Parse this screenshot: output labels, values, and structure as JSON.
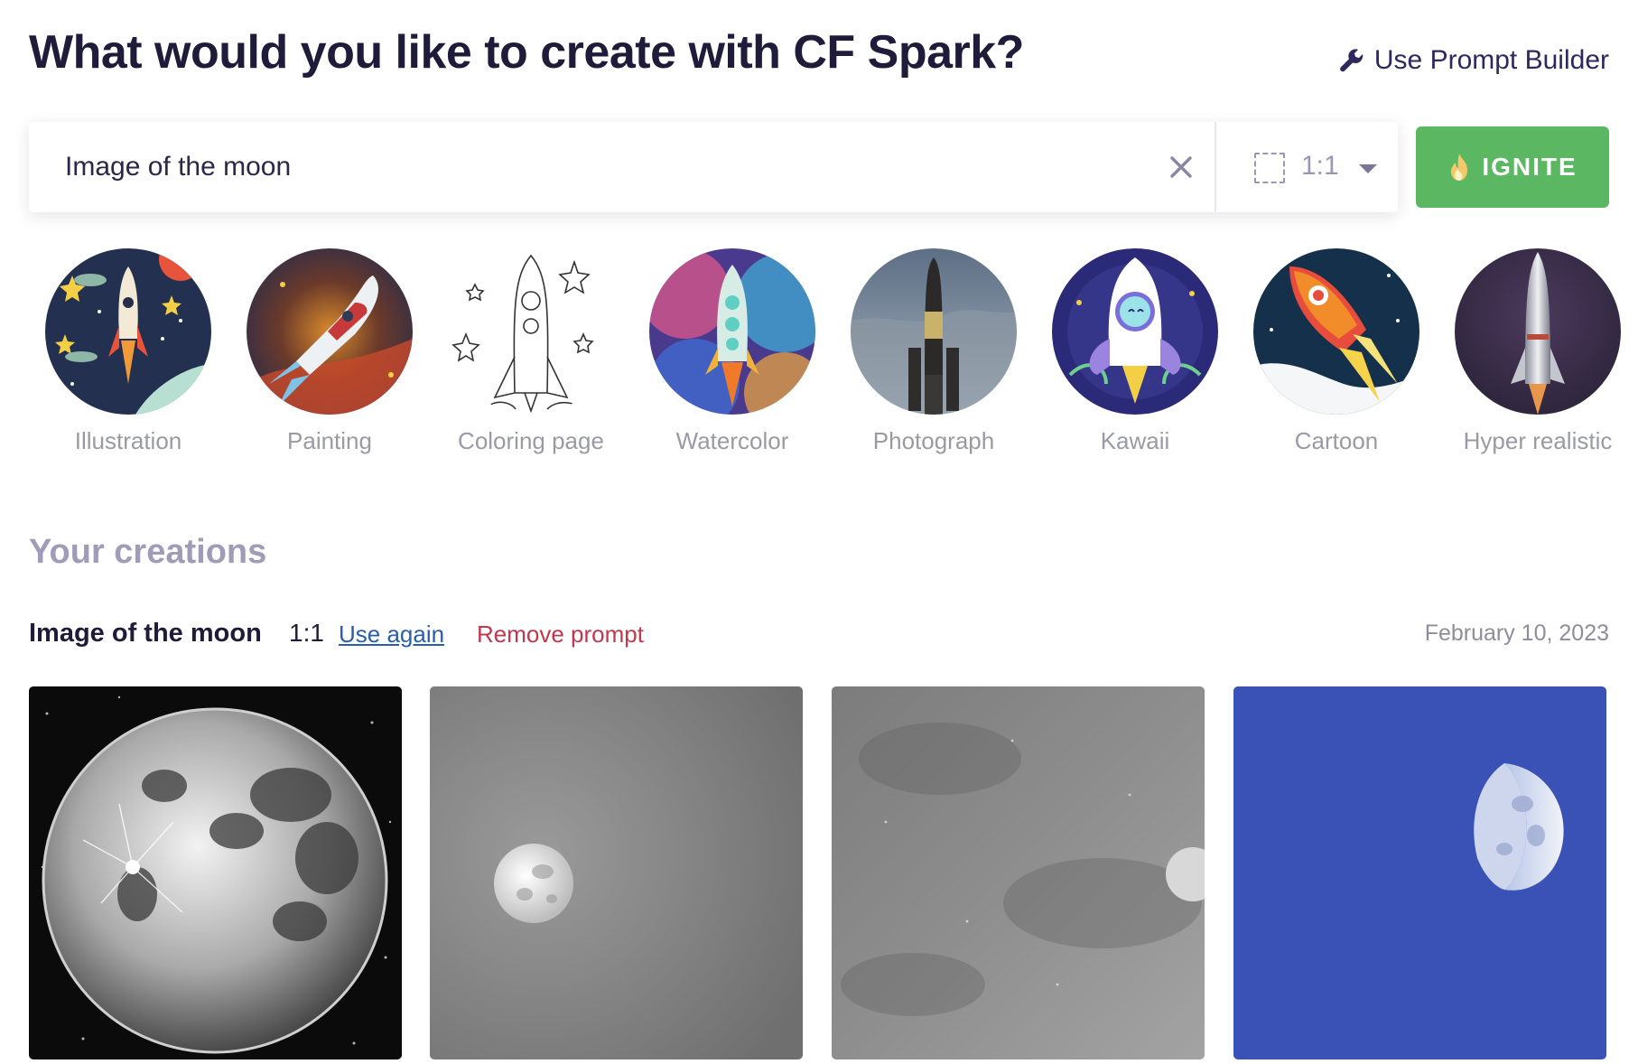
{
  "header": {
    "title": "What would you like to create with CF Spark?",
    "prompt_builder_label": "Use Prompt Builder",
    "prompt_builder_icon": "wrench-icon"
  },
  "search": {
    "value": "Image of the moon",
    "placeholder": "",
    "clear_icon": "close-icon",
    "ratio_icon": "aspect-ratio-icon",
    "ratio": "1:1",
    "ignite_label": "IGNITE",
    "ignite_icon": "flame-icon"
  },
  "styles": [
    {
      "label": "Illustration"
    },
    {
      "label": "Painting"
    },
    {
      "label": "Coloring page"
    },
    {
      "label": "Watercolor"
    },
    {
      "label": "Photograph"
    },
    {
      "label": "Kawaii"
    },
    {
      "label": "Cartoon"
    },
    {
      "label": "Hyper realistic"
    }
  ],
  "creations": {
    "heading": "Your creations",
    "prompt": "Image of the moon",
    "ratio": "1:1",
    "use_again_label": "Use again",
    "remove_label": "Remove prompt",
    "date": "February 10, 2023"
  },
  "colors": {
    "accent_green": "#5cb763",
    "title": "#1f1b3a",
    "link_blue": "#2a5ea8",
    "remove_red": "#c0384d",
    "blue_tile": "#3a52b6"
  }
}
